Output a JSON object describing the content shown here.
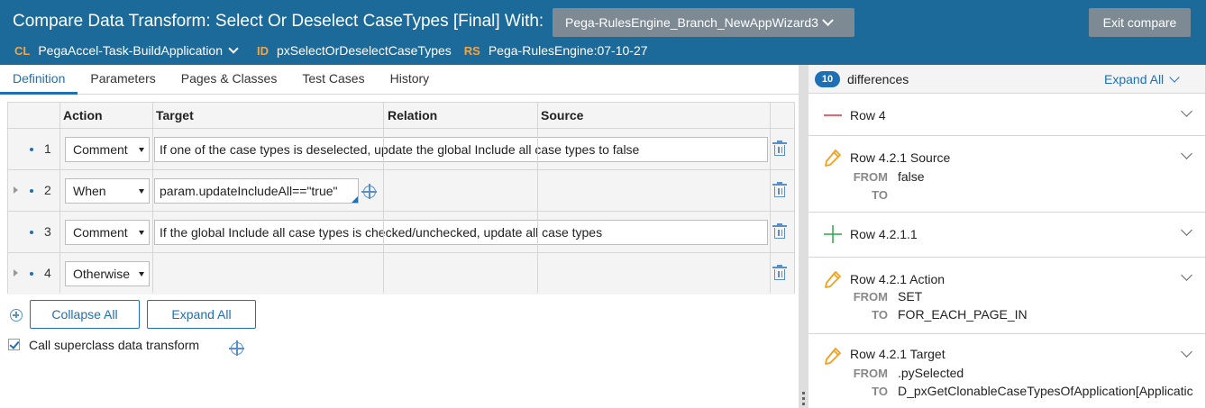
{
  "header": {
    "title": "Compare Data Transform: Select Or Deselect CaseTypes [Final] With:",
    "branch_select": "Pega-RulesEngine_Branch_NewAppWizard3",
    "exit_label": "Exit compare",
    "meta": {
      "cl_tag": "CL",
      "cl_value": "PegaAccel-Task-BuildApplication",
      "id_tag": "ID",
      "id_value": "pxSelectOrDeselectCaseTypes",
      "rs_tag": "RS",
      "rs_value": "Pega-RulesEngine:07-10-27"
    }
  },
  "tabs": [
    {
      "label": "Definition",
      "active": true
    },
    {
      "label": "Parameters"
    },
    {
      "label": "Pages & Classes"
    },
    {
      "label": "Test Cases"
    },
    {
      "label": "History"
    }
  ],
  "grid": {
    "headers": {
      "action": "Action",
      "target": "Target",
      "relation": "Relation",
      "source": "Source"
    },
    "rows": [
      {
        "num": "1",
        "action": "Comment",
        "target": "If one of the case types is deselected, update the global Include all case types to false"
      },
      {
        "num": "2",
        "action": "When",
        "target": "param.updateIncludeAll==\"true\""
      },
      {
        "num": "3",
        "action": "Comment",
        "target": "If the global Include all case types is checked/unchecked, update all case types"
      },
      {
        "num": "4",
        "action": "Otherwise",
        "target": ""
      }
    ]
  },
  "actions": {
    "collapse_all": "Collapse All",
    "expand_all": "Expand All",
    "call_superclass": "Call superclass data transform",
    "call_superclass_checked": true
  },
  "diff_panel": {
    "count": "10",
    "label": "differences",
    "expand_all": "Expand All",
    "items": [
      {
        "type": "removed",
        "title": "Row 4"
      },
      {
        "type": "changed",
        "title": "Row 4.2.1 Source",
        "from_label": "FROM",
        "from": "false",
        "to_label": "TO",
        "to": ""
      },
      {
        "type": "added",
        "title": "Row 4.2.1.1"
      },
      {
        "type": "changed",
        "title": "Row 4.2.1 Action",
        "from_label": "FROM",
        "from": "SET",
        "to_label": "TO",
        "to": "FOR_EACH_PAGE_IN"
      },
      {
        "type": "changed",
        "title": "Row 4.2.1 Target",
        "from_label": "FROM",
        "from": ".pySelected",
        "to_label": "TO",
        "to": "D_pxGetClonableCaseTypesOfApplication[Applicatic"
      }
    ]
  },
  "colors": {
    "header_bg": "#1b6a9a",
    "accent": "#1f6fb5",
    "tag_orange": "#f0a64b",
    "removed_red": "#d9363e",
    "added_green": "#2ca84a",
    "changed_orange": "#f0a020"
  }
}
